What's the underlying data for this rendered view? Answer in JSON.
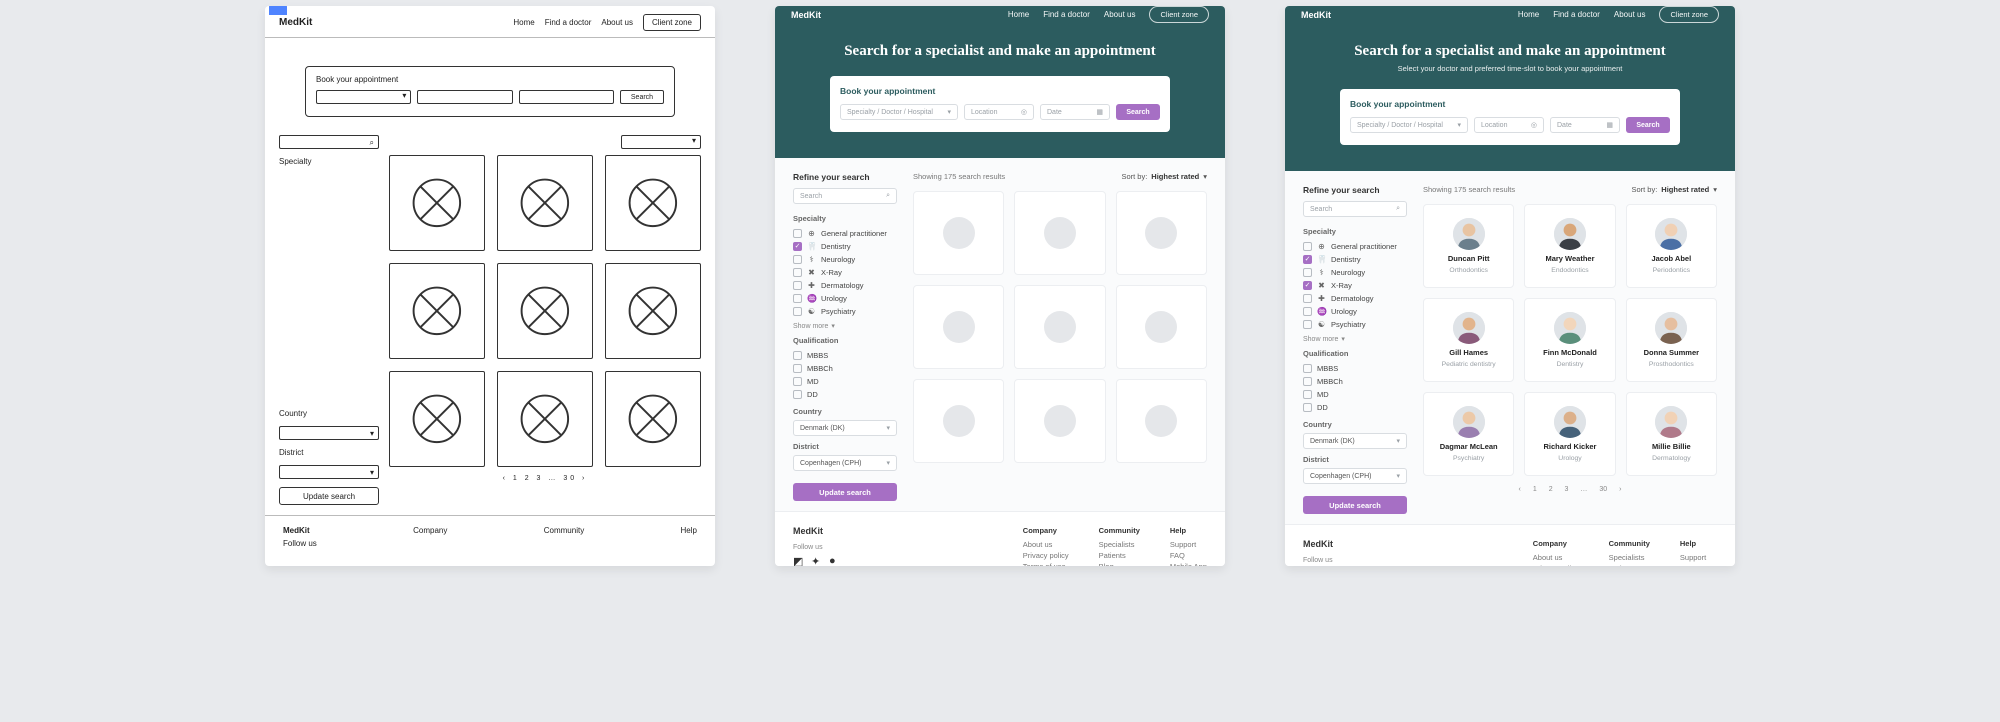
{
  "brand": "MedKit",
  "nav": {
    "home": "Home",
    "find": "Find a doctor",
    "about": "About us",
    "client": "Client zone"
  },
  "hero": {
    "title": "Search for a specialist and make an appointment",
    "subtitle": "Select your doctor and preferred time-slot to book your appointment"
  },
  "appt": {
    "title": "Book your appointment",
    "ph_specialty": "Specialty / Doctor / Hospital",
    "ph_location": "Location",
    "ph_date": "Date",
    "search": "Search"
  },
  "filters": {
    "title": "Refine your search",
    "search_ph": "Search",
    "specialty_label": "Specialty",
    "specialties": [
      {
        "label": "General practitioner",
        "icon": "⊕"
      },
      {
        "label": "Dentistry",
        "icon": "🦷"
      },
      {
        "label": "Neurology",
        "icon": "⚕"
      },
      {
        "label": "X-Ray",
        "icon": "✖"
      },
      {
        "label": "Dermatology",
        "icon": "✚"
      },
      {
        "label": "Urology",
        "icon": "♒"
      },
      {
        "label": "Psychiatry",
        "icon": "☯"
      }
    ],
    "specialties_checked_v2": [
      false,
      true,
      false,
      false,
      false,
      false,
      false
    ],
    "specialties_checked_v3": [
      false,
      true,
      false,
      true,
      false,
      false,
      false
    ],
    "show_more": "Show more",
    "qual_label": "Qualification",
    "quals": [
      "MBBS",
      "MBBCh",
      "MD",
      "DD"
    ],
    "country_label": "Country",
    "country_value": "Denmark (DK)",
    "district_label": "District",
    "district_value": "Copenhagen (CPH)",
    "update": "Update search"
  },
  "results": {
    "count_text": "Showing 175 search results",
    "sort_label": "Sort by:",
    "sort_value": "Highest rated"
  },
  "doctors": [
    {
      "name": "Duncan Pitt",
      "spec": "Orthodontics"
    },
    {
      "name": "Mary Weather",
      "spec": "Endodontics"
    },
    {
      "name": "Jacob Abel",
      "spec": "Periodontics"
    },
    {
      "name": "Gill Hames",
      "spec": "Pediatric dentistry"
    },
    {
      "name": "Finn McDonald",
      "spec": "Dentistry"
    },
    {
      "name": "Donna Summer",
      "spec": "Prosthodontics"
    },
    {
      "name": "Dagmar McLean",
      "spec": "Psychiatry"
    },
    {
      "name": "Richard Kicker",
      "spec": "Urology"
    },
    {
      "name": "Millie Billie",
      "spec": "Dermatology"
    }
  ],
  "pager": {
    "prev": "‹",
    "pages": [
      "1",
      "2",
      "3",
      "…",
      "30"
    ],
    "next": "›"
  },
  "footer": {
    "follow": "Follow us",
    "cols": [
      {
        "title": "Company",
        "links": [
          "About us",
          "Privacy policy",
          "Terms of use"
        ]
      },
      {
        "title": "Community",
        "links": [
          "Specialists",
          "Patients",
          "Blog"
        ]
      },
      {
        "title": "Help",
        "links": [
          "Support",
          "FAQ",
          "Mobile App"
        ]
      }
    ]
  },
  "sketch": {
    "appt_title": "Book your appointment",
    "search": "Search",
    "specialty": "Specialty",
    "country": "Country",
    "district": "District",
    "update": "Update search",
    "footer_brand": "MedKit",
    "footer_follow": "Follow us",
    "footer_cols": [
      "Company",
      "Community",
      "Help"
    ]
  },
  "avatar_colors": {
    "skin": [
      "#e8c4a2",
      "#d9a77a",
      "#f0d0b4",
      "#e2b48c",
      "#f2d6bb",
      "#e6bfa0",
      "#ecc9a8",
      "#dcb08a",
      "#f1d2b6"
    ],
    "shirt": [
      "#6b7f8c",
      "#3b3f46",
      "#4a6fa5",
      "#8a5a7a",
      "#5a8f7b",
      "#7a6250",
      "#9a7fb0",
      "#46627a",
      "#b07a8a"
    ]
  }
}
